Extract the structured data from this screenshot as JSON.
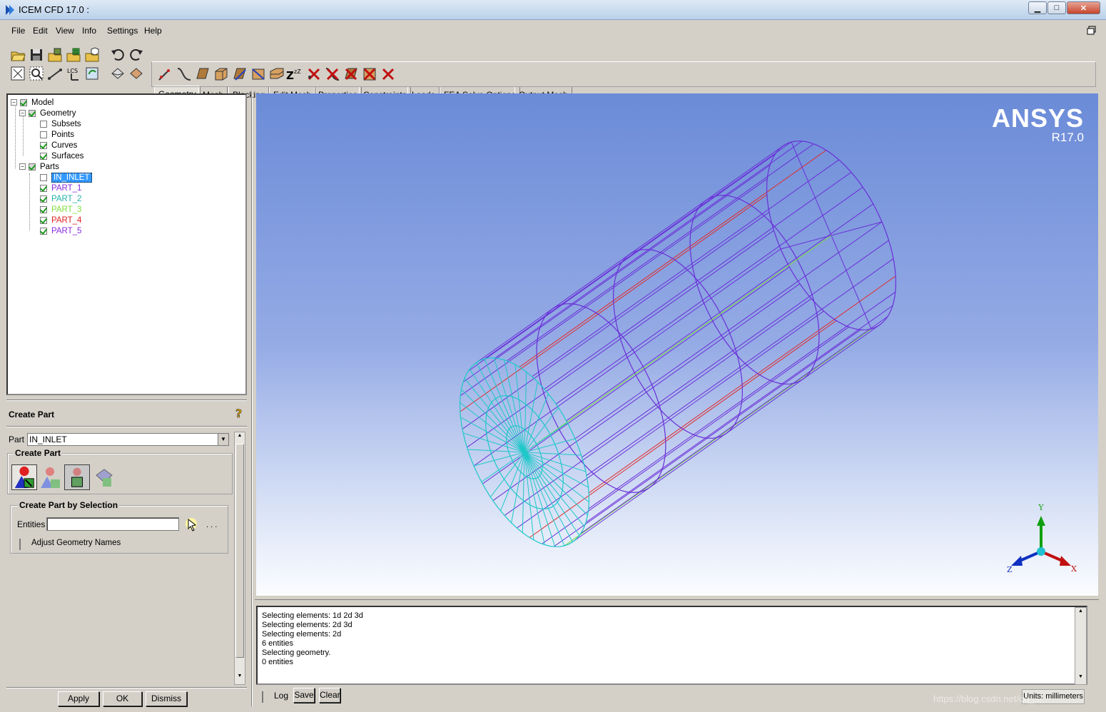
{
  "window": {
    "title": "ICEM CFD 17.0 :",
    "minimize": "▁",
    "maximize": "□",
    "close": "✕",
    "restore_icon": "restore-icon"
  },
  "menu": [
    "File",
    "Edit",
    "View",
    "Info",
    "Settings",
    "Help"
  ],
  "tabs": [
    "Geometry",
    "Mesh",
    "Blocking",
    "Edit Mesh",
    "Properties",
    "Constraints",
    "Loads",
    "FEA Solve Options",
    "Output Mesh"
  ],
  "tree": {
    "model": "Model",
    "geometry": "Geometry",
    "subsets": "Subsets",
    "points": "Points",
    "curves": "Curves",
    "surfaces": "Surfaces",
    "parts": "Parts",
    "part_items": [
      {
        "label": "IN_INLET",
        "color": "#ffffff",
        "checked": false,
        "selected": true
      },
      {
        "label": "PART_1",
        "color": "#8a2be2",
        "checked": true
      },
      {
        "label": "PART_2",
        "color": "#20b2aa",
        "checked": true
      },
      {
        "label": "PART_3",
        "color": "#7fdc3c",
        "checked": true
      },
      {
        "label": "PART_4",
        "color": "#e02020",
        "checked": true
      },
      {
        "label": "PART_5",
        "color": "#8a2be2",
        "checked": true
      }
    ]
  },
  "create_part": {
    "title": "Create Part",
    "part_label": "Part",
    "part_value": "IN_INLET",
    "group_label": "Create Part",
    "selection_group": "Create Part by Selection",
    "entities_label": "Entities",
    "entities_value": "",
    "ellipsis": ". . .",
    "adjust_label": "Adjust Geometry Names",
    "apply": "Apply",
    "ok": "OK",
    "dismiss": "Dismiss"
  },
  "viewport": {
    "logo": "ANSYS",
    "version": "R17.0",
    "axis_y": "Y",
    "axis_x": "X",
    "axis_z": "Z"
  },
  "console": {
    "lines": [
      "Selecting elements: 1d 2d 3d",
      "Selecting elements: 2d 3d",
      "Selecting elements: 2d",
      "6 entities",
      "Selecting geometry.",
      "0 entities"
    ],
    "log": "Log",
    "save": "Save",
    "clear": "Clear",
    "units": "Units: millimeters"
  },
  "watermark": "https://blog.csdn.net/qq_..."
}
